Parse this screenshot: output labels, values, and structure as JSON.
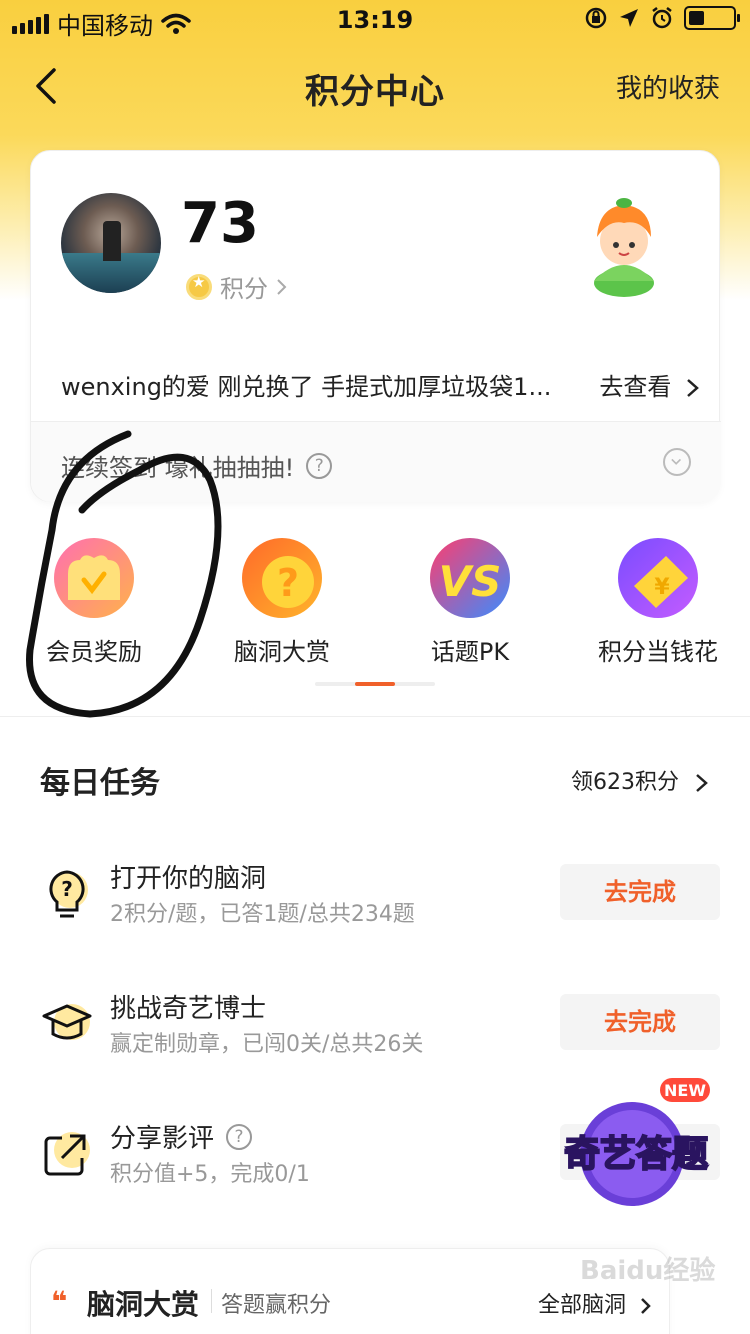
{
  "status_bar": {
    "carrier": "中国移动",
    "time": "13:19",
    "battery_level": 0.35
  },
  "nav": {
    "title": "积分中心",
    "right_link": "我的收获"
  },
  "points_card": {
    "points": "73",
    "points_label": "积分",
    "notice": "wenxing的爱 刚兑换了 手提式加厚垃圾袋1...",
    "notice_action": "去查看",
    "sign_in_text": "连续签到 壕礼抽抽抽!"
  },
  "features": [
    {
      "label": "会员奖励",
      "icon": "vip-reward-icon",
      "color": "#ff5fa0"
    },
    {
      "label": "脑洞大赏",
      "icon": "question-icon",
      "color": "#ff8a2a"
    },
    {
      "label": "话题PK",
      "icon": "vs-icon",
      "color": "#ff4d6d"
    },
    {
      "label": "积分当钱花",
      "icon": "coupon-icon",
      "color": "#9b5cff"
    }
  ],
  "pager": {
    "pages": 3,
    "active": 2
  },
  "daily_tasks": {
    "title": "每日任务",
    "more": "领623积分",
    "items": [
      {
        "name": "打开你的脑洞",
        "desc": "2积分/题，已答1题/总共234题",
        "button": "去完成",
        "icon": "lightbulb-question-icon"
      },
      {
        "name": "挑战奇艺博士",
        "desc": "赢定制勋章，已闯0关/总共26关",
        "button": "去完成",
        "icon": "graduation-cap-icon"
      },
      {
        "name": "分享影评",
        "desc": "积分值+5，完成0/1",
        "button": "",
        "icon": "share-icon"
      }
    ]
  },
  "qiyi_badge": {
    "new_label": "NEW",
    "text": "奇艺答题"
  },
  "bottom_card": {
    "quote": "❝",
    "title": "脑洞大赏",
    "subtitle": "答题赢积分",
    "more": "全部脑洞"
  },
  "watermark": "Baidu经验",
  "colors": {
    "accent": "#f0602a",
    "header_yellow": "#f9cf3f"
  }
}
